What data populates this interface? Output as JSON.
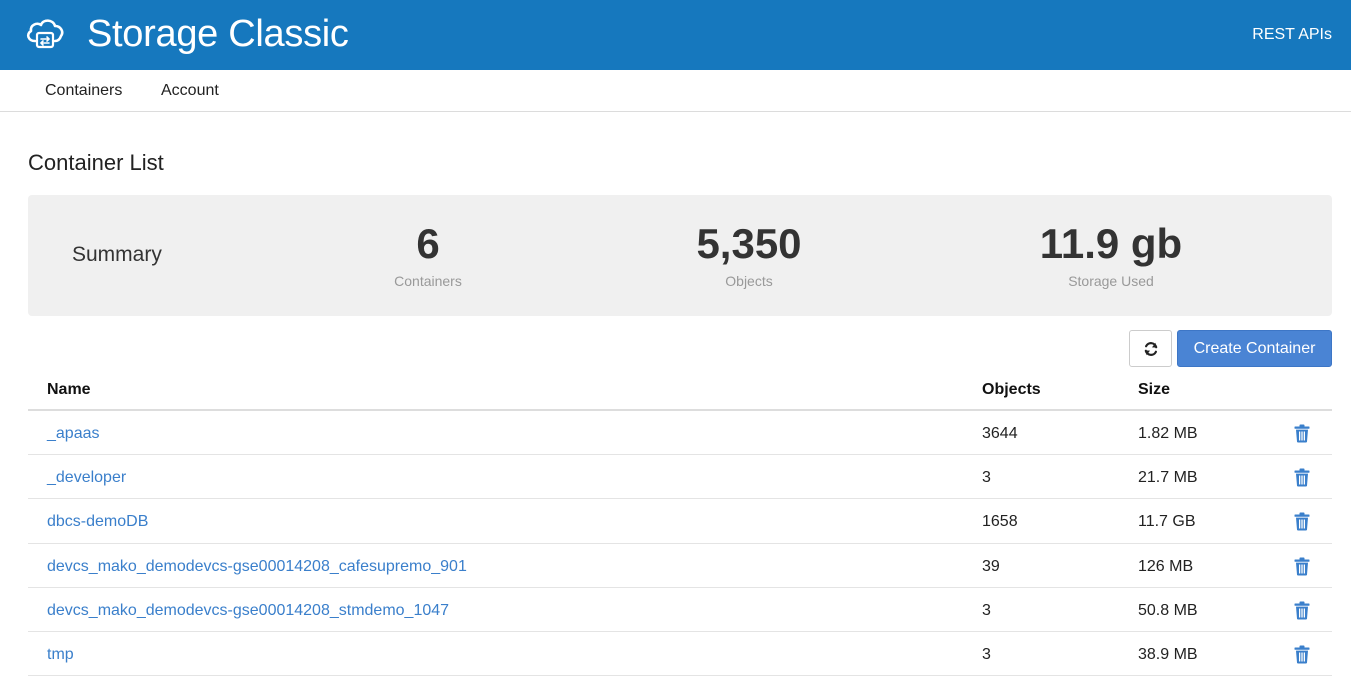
{
  "header": {
    "title": "Storage Classic",
    "rest_link": "REST APIs",
    "logo_icon": "cloud-icon",
    "bg_color": "#1678be"
  },
  "nav": {
    "tabs": [
      {
        "label": "Containers"
      },
      {
        "label": "Account"
      }
    ]
  },
  "page": {
    "title": "Container List"
  },
  "summary": {
    "label": "Summary",
    "stats": [
      {
        "value": "6",
        "caption": "Containers"
      },
      {
        "value": "5,350",
        "caption": "Objects"
      },
      {
        "value": "11.9 gb",
        "caption": "Storage Used"
      }
    ]
  },
  "toolbar": {
    "refresh_icon": "refresh-icon",
    "create_label": "Create Container",
    "accent_color": "#4a84d4"
  },
  "table": {
    "columns": {
      "name": "Name",
      "objects": "Objects",
      "size": "Size"
    },
    "rows": [
      {
        "name": "_apaas",
        "objects": "3644",
        "size": "1.82 MB"
      },
      {
        "name": "_developer",
        "objects": "3",
        "size": "21.7 MB"
      },
      {
        "name": "dbcs-demoDB",
        "objects": "1658",
        "size": "11.7 GB"
      },
      {
        "name": "devcs_mako_demodevcs-gse00014208_cafesupremo_901",
        "objects": "39",
        "size": "126 MB"
      },
      {
        "name": "devcs_mako_demodevcs-gse00014208_stmdemo_1047",
        "objects": "3",
        "size": "50.8 MB"
      },
      {
        "name": "tmp",
        "objects": "3",
        "size": "38.9 MB"
      }
    ],
    "row_action_icon": "trash-icon",
    "link_color": "#3a7fcb"
  }
}
